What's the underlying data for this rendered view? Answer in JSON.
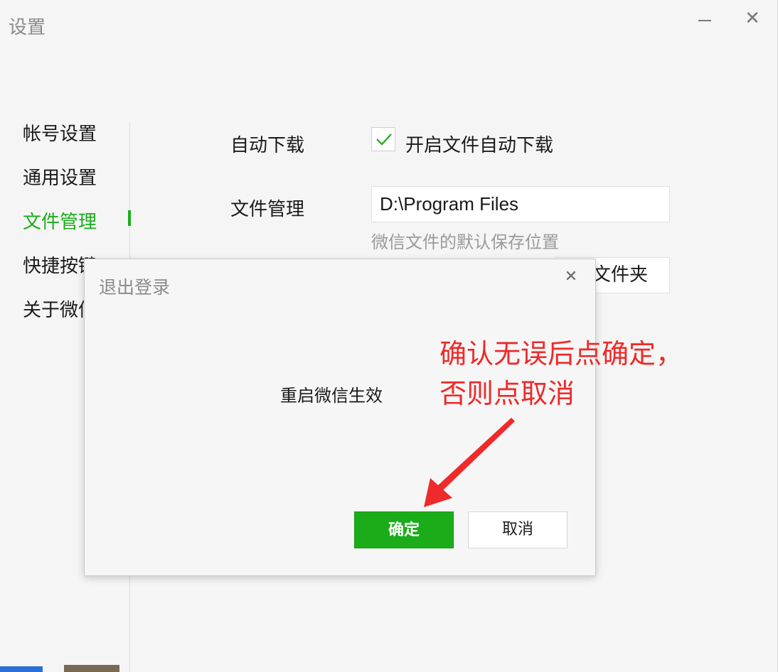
{
  "window": {
    "title": "设置"
  },
  "sidebar": {
    "items": [
      {
        "label": "帐号设置"
      },
      {
        "label": "通用设置"
      },
      {
        "label": "文件管理"
      },
      {
        "label": "快捷按键"
      },
      {
        "label": "关于微信"
      }
    ],
    "active_index": 2
  },
  "content": {
    "auto_download": {
      "label": "自动下载",
      "checkbox_label": "开启文件自动下载",
      "checked": true
    },
    "file_management": {
      "label": "文件管理",
      "path_value": "D:\\Program Files",
      "hint": "微信文件的默认保存位置",
      "open_folder_label": "打开文件夹"
    }
  },
  "dialog": {
    "title": "退出登录",
    "message": "重启微信生效",
    "ok_label": "确定",
    "cancel_label": "取消",
    "close_icon": "close-icon"
  },
  "annotation": {
    "line1": "确认无误后点确定，",
    "line2": "否则点取消"
  },
  "colors": {
    "accent_green": "#1aad19",
    "annotation_red": "#ee2a2a"
  }
}
